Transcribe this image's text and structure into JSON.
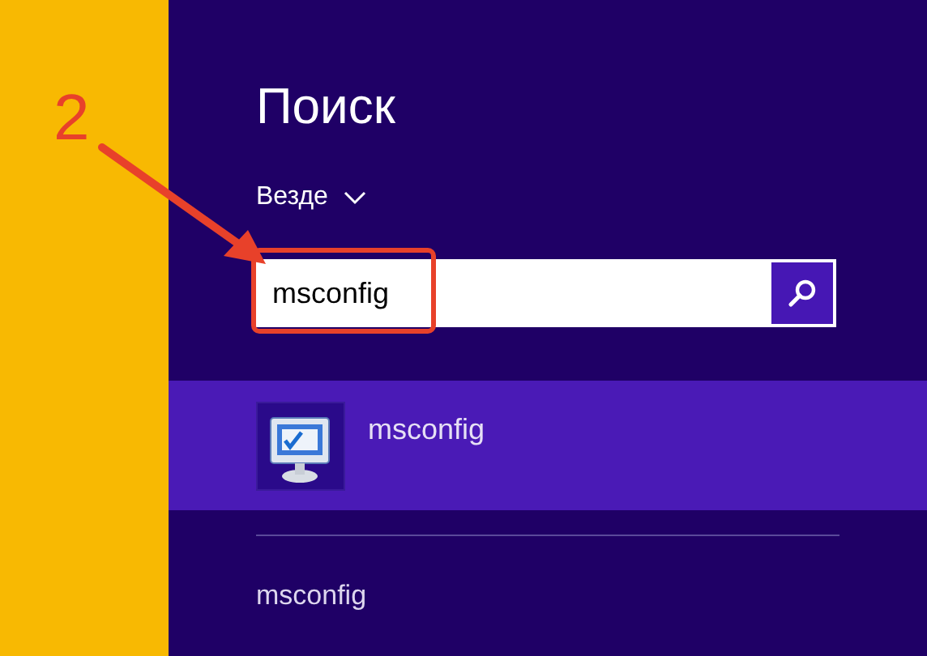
{
  "annotation": {
    "step": "2"
  },
  "title": "Поиск",
  "scope": {
    "label": "Везде"
  },
  "search": {
    "value": "msconfig"
  },
  "results": [
    {
      "kind": "app",
      "label": "msconfig",
      "selected": true
    },
    {
      "kind": "suggestion",
      "label": "msconfig",
      "selected": false
    }
  ]
}
